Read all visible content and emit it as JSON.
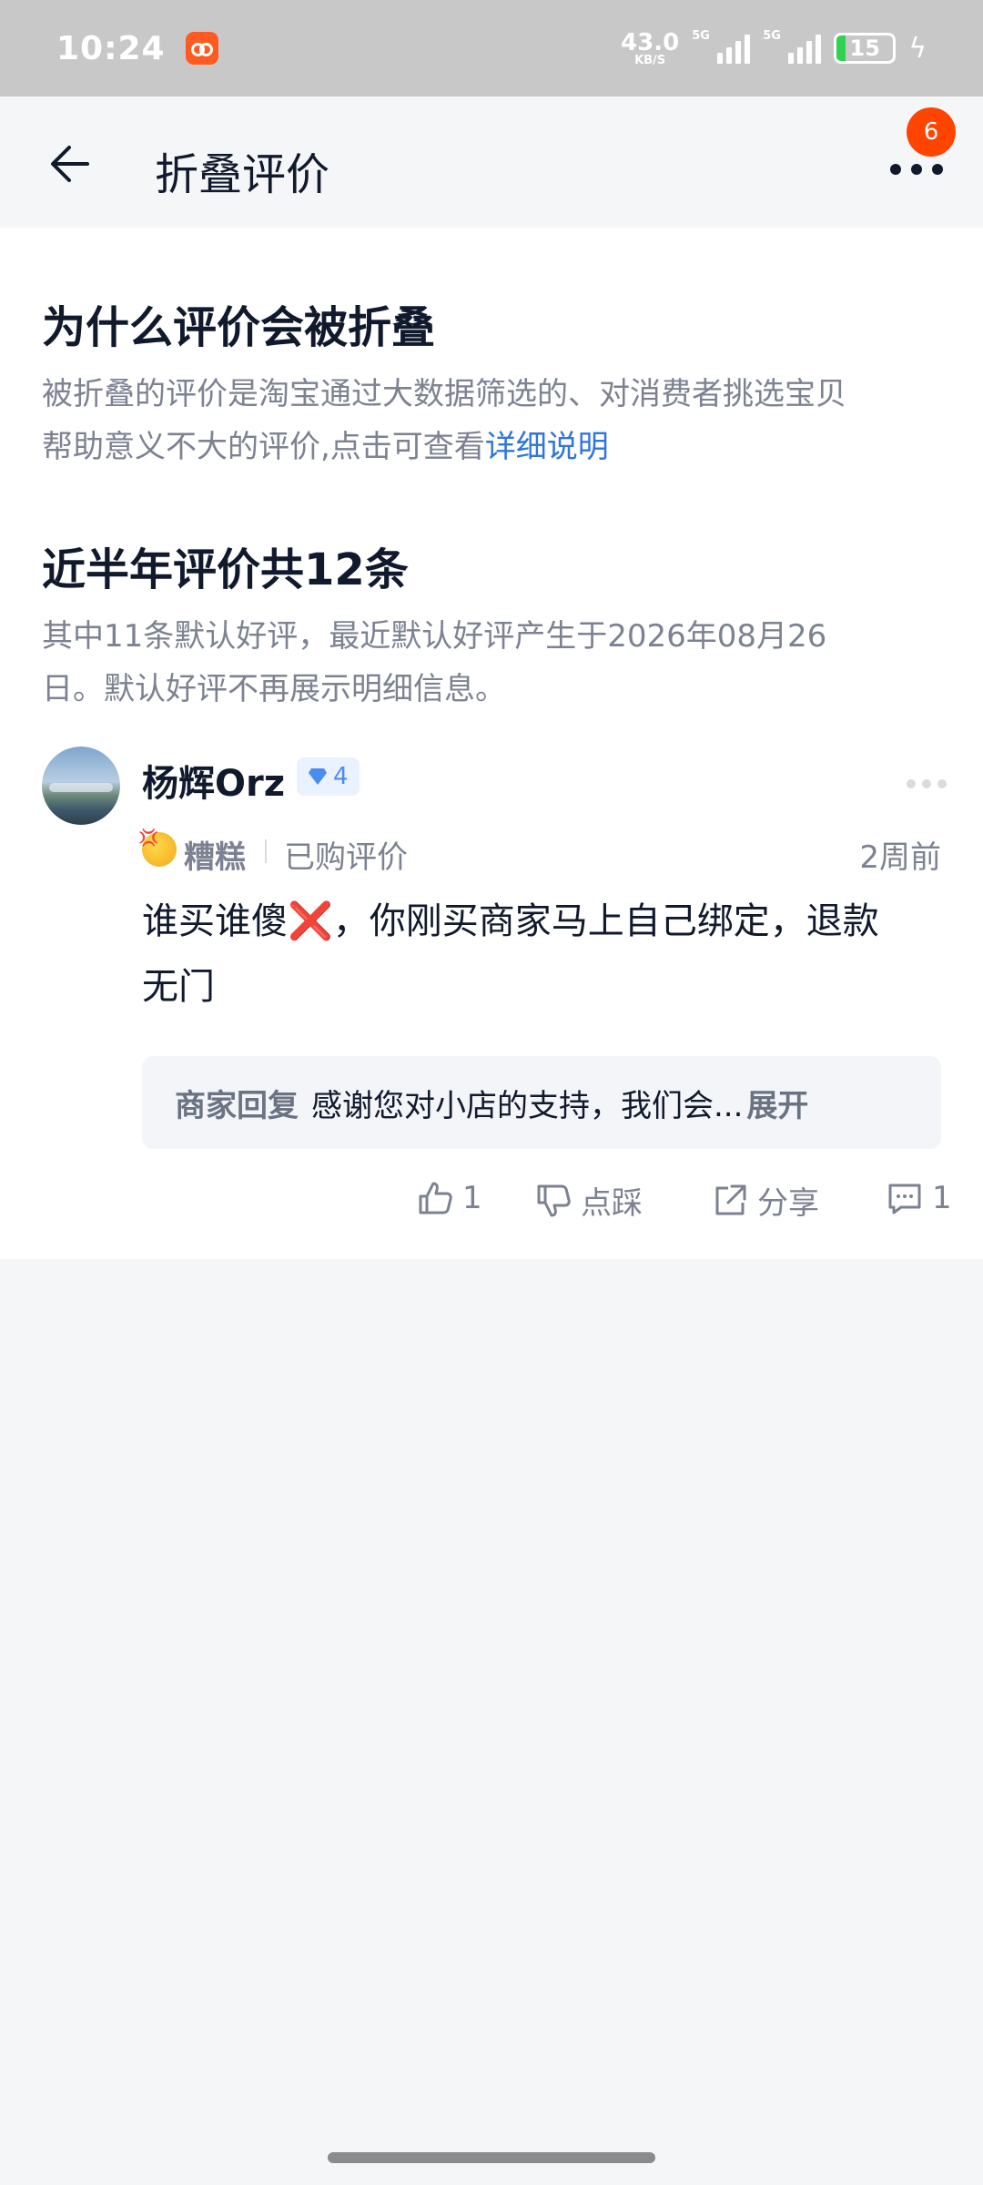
{
  "status_bar": {
    "time": "10:24",
    "net_speed": "43.0",
    "net_unit": "KB/S",
    "signal1_tag": "5G",
    "signal2_tag": "5G",
    "battery": "15"
  },
  "nav": {
    "title": "折叠评价",
    "badge_count": "6"
  },
  "why_section": {
    "title": "为什么评价会被折叠",
    "desc_line1": "被折叠的评价是淘宝通过大数据筛选的、对消费者挑选宝贝",
    "desc_line2": "帮助意义不大的评价,点击可查看",
    "link": "详细说明"
  },
  "count_section": {
    "title": "近半年评价共12条",
    "desc_line1": "其中11条默认好评，最近默认好评产生于2026年08月26",
    "desc_line2": "日。默认好评不再展示明细信息。"
  },
  "review": {
    "username": "杨辉Orz",
    "level": "4",
    "rating": "糟糕",
    "verified": "已购评价",
    "time": "2周前",
    "body_line1": "谁买谁傻❌，你刚买商家马上自己绑定，退款",
    "body_line2": "无门",
    "reply_label": "商家回复",
    "reply_text": "感谢您对小店的支持，我们会...",
    "reply_expand": "展开",
    "likes": "1",
    "dislike_label": "点踩",
    "share_label": "分享",
    "comments": "1"
  },
  "colors": {
    "accent": "#ff4400",
    "link": "#2e76d9",
    "text_primary": "#11192d",
    "text_secondary": "#7c8291"
  }
}
